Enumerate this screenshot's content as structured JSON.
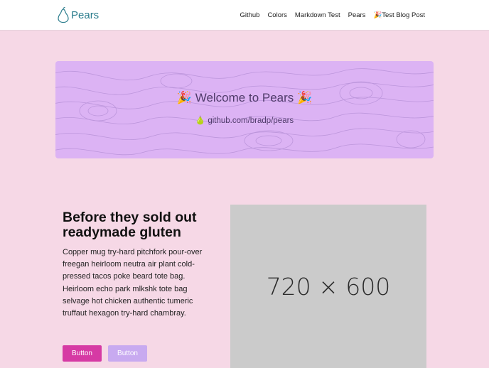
{
  "navbar": {
    "brand": "Pears",
    "links": [
      "Github",
      "Colors",
      "Markdown Test",
      "Pears",
      "🎉Test Blog Post"
    ]
  },
  "hero": {
    "title": "🎉 Welcome to Pears 🎉",
    "subtitle": "🍐 github.com/bradp/pears"
  },
  "feature": {
    "title": "Before they sold out readymade gluten",
    "body": "Copper mug try-hard pitchfork pour-over freegan heirloom neutra air plant cold-pressed tacos poke beard tote bag. Heirloom echo park mlkshk tote bag selvage hot chicken authentic tumeric truffaut hexagon try-hard chambray.",
    "primary_button": "Button",
    "secondary_button": "Button",
    "image_placeholder": "720 × 600"
  },
  "colors": {
    "page_background": "#f6d8e6",
    "hero_background": "#dcb3f4",
    "brand": "#2a7c8c",
    "primary": "#d63aa4",
    "secondary": "#c8aaf0"
  },
  "icons": {
    "brand": "pear-icon"
  }
}
